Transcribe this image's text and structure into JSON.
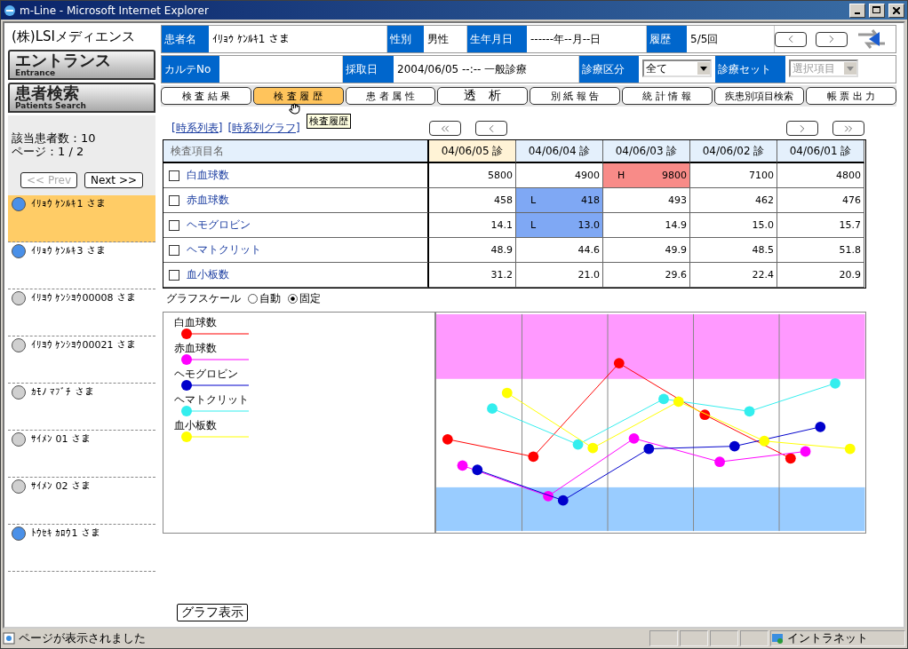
{
  "window": {
    "title": "m-Line - Microsoft Internet Explorer"
  },
  "company": "(株)LSIメディエンス",
  "nav": [
    {
      "title": "エントランス",
      "subtitle": "Entrance"
    },
    {
      "title": "患者検索",
      "subtitle": "Patients Search"
    }
  ],
  "patient_count": "該当患者数：10",
  "page": "ページ：1 / 2",
  "pager": [
    {
      "label": "<< Prev",
      "disabled": true
    },
    {
      "label": "Next >>",
      "disabled": false
    }
  ],
  "patients": [
    {
      "name": "ｲﾘｮｳ ｹﾝﾙｷ1 さま",
      "selected": true,
      "color": "#4a90e8"
    },
    {
      "name": "ｲﾘｮｳ ｹﾝﾙｷ3 さま",
      "selected": false,
      "color": "#4a90e8"
    },
    {
      "name": "ｲﾘﾖｳ ｹﾝｼﾖｳ00008 さま",
      "selected": false,
      "color": "#d0d0d0"
    },
    {
      "name": "ｲﾘﾖｳ ｹﾝｼﾖｳ00021 さま",
      "selected": false,
      "color": "#d0d0d0"
    },
    {
      "name": "ｶﾓﾉ ﾏﾌﾞﾁ さま",
      "selected": false,
      "color": "#d0d0d0"
    },
    {
      "name": "ｻｲﾒﾝ 01 さま",
      "selected": false,
      "color": "#d0d0d0"
    },
    {
      "name": "ｻｲﾒﾝ 02 さま",
      "selected": false,
      "color": "#d0d0d0"
    },
    {
      "name": "ﾄｳｾｷ ｶﾛｳ1 さま",
      "selected": false,
      "color": "#4a90e8"
    }
  ],
  "header_row_1": [
    {
      "label": "患者名",
      "value": "ｲﾘｮｳ ｹﾝﾙｷ1 さま"
    },
    {
      "label": "性別",
      "value": "男性"
    },
    {
      "label": "生年月日",
      "value": "------年--月--日"
    },
    {
      "label": "履歴",
      "value": "5/5回"
    }
  ],
  "header_row_2": [
    {
      "label": "カルテNo",
      "kind": "text"
    },
    {
      "label": "採取日",
      "kind": "text",
      "value": "2004/06/05 --:-- 一般診療"
    },
    {
      "label": "診療区分",
      "kind": "select",
      "value": "全て",
      "disabled": false
    },
    {
      "label": "診療セット",
      "kind": "select",
      "placeholder": "選択項目",
      "disabled": true
    }
  ],
  "tabs": [
    {
      "label": "検 査 結 果",
      "selected": false
    },
    {
      "label": "検 査 履 歴",
      "selected": true
    },
    {
      "label": "患 者 属 性",
      "selected": false
    },
    {
      "label": "透　析",
      "selected": false
    },
    {
      "label": "別 紙 報 告",
      "selected": false
    },
    {
      "label": "統 計 情 報",
      "selected": false
    },
    {
      "label": "疾患別項目検索",
      "selected": false
    },
    {
      "label": "帳 票 出 力",
      "selected": false
    }
  ],
  "tooltip": "検査履歴",
  "links": [
    "[時系列表]",
    "[時系列グラフ]"
  ],
  "table": {
    "item_header": "検査項目名",
    "dates": [
      {
        "label": "04/06/05 診",
        "selected": true
      },
      {
        "label": "04/06/04 診",
        "selected": false
      },
      {
        "label": "04/06/03 診",
        "selected": false
      },
      {
        "label": "04/06/02 診",
        "selected": false
      },
      {
        "label": "04/06/01 診",
        "selected": false
      }
    ],
    "rows": [
      {
        "name": "白血球数",
        "checked": false,
        "cells": [
          {
            "value": "5800"
          },
          {
            "value": "4900"
          },
          {
            "value": "9800",
            "color": "#f88b88",
            "flag": "H"
          },
          {
            "value": "7100"
          },
          {
            "value": "4800"
          }
        ]
      },
      {
        "name": "赤血球数",
        "checked": false,
        "cells": [
          {
            "value": "458"
          },
          {
            "value": "418",
            "color": "#7fa8f4",
            "flag": "L"
          },
          {
            "value": "493"
          },
          {
            "value": "462"
          },
          {
            "value": "476"
          }
        ]
      },
      {
        "name": "ヘモグロビン",
        "checked": false,
        "cells": [
          {
            "value": "14.1"
          },
          {
            "value": "13.0",
            "color": "#7fa8f4",
            "flag": "L"
          },
          {
            "value": "14.9"
          },
          {
            "value": "15.0"
          },
          {
            "value": "15.7"
          }
        ]
      },
      {
        "name": "ヘマトクリット",
        "checked": false,
        "cells": [
          {
            "value": "48.9"
          },
          {
            "value": "44.6"
          },
          {
            "value": "49.9"
          },
          {
            "value": "48.5"
          },
          {
            "value": "51.8"
          }
        ]
      },
      {
        "name": "血小板数",
        "checked": false,
        "cells": [
          {
            "value": "31.2"
          },
          {
            "value": "21.0"
          },
          {
            "value": "29.6"
          },
          {
            "value": "22.4"
          },
          {
            "value": "20.9"
          }
        ]
      }
    ]
  },
  "graph_scale": {
    "label": "グラフスケール",
    "options": [
      {
        "label": "自動",
        "selected": false
      },
      {
        "label": "固定",
        "selected": true
      }
    ]
  },
  "legend": [
    {
      "name": "白血球数",
      "color": "#ff0000"
    },
    {
      "name": "赤血球数",
      "color": "#ff00ff"
    },
    {
      "name": "ヘモグロビン",
      "color": "#0000cc"
    },
    {
      "name": "ヘマトクリット",
      "color": "#33eeee"
    },
    {
      "name": "血小板数",
      "color": "#ffff00"
    }
  ],
  "graph_button": "グラフ表示",
  "status_bar": {
    "text": "ページが表示されました",
    "zone": "イントラネット"
  }
}
